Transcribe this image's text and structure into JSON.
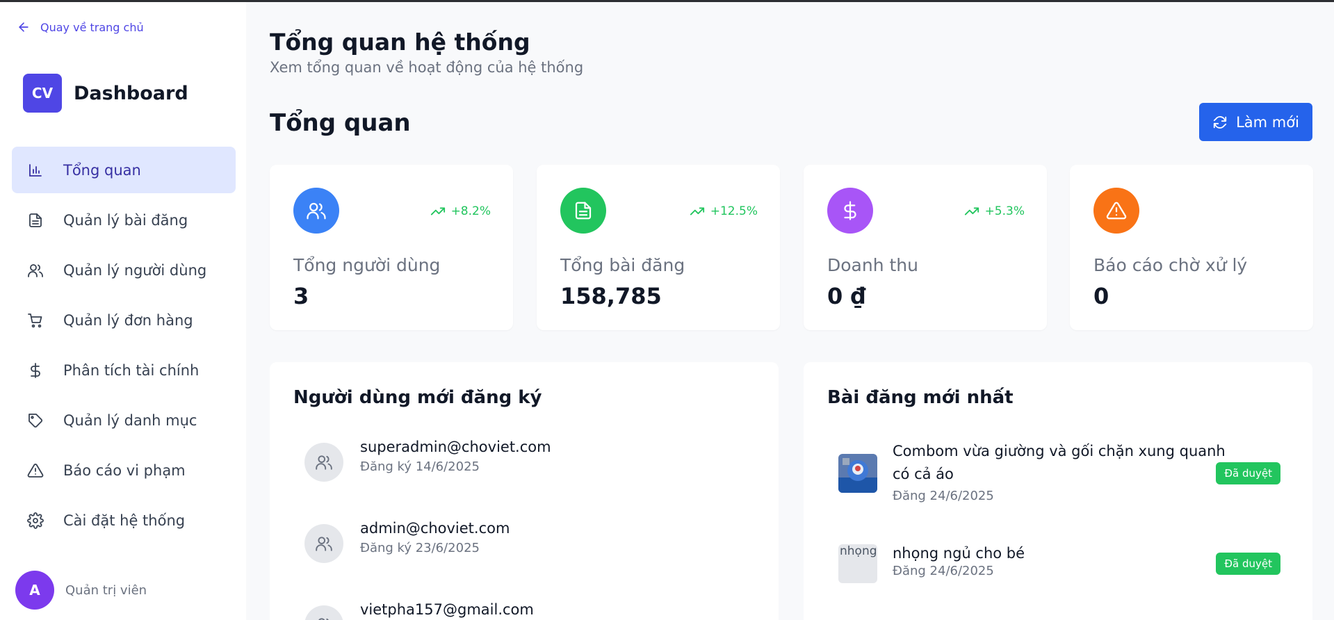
{
  "sidebar": {
    "back_link": "Quay về trang chủ",
    "logo_text": "CV",
    "brand_title": "Dashboard",
    "items": [
      {
        "label": "Tổng quan",
        "icon": "bar-chart-icon",
        "active": true
      },
      {
        "label": "Quản lý bài đăng",
        "icon": "document-icon",
        "active": false
      },
      {
        "label": "Quản lý người dùng",
        "icon": "users-icon",
        "active": false
      },
      {
        "label": "Quản lý đơn hàng",
        "icon": "cart-icon",
        "active": false
      },
      {
        "label": "Phân tích tài chính",
        "icon": "dollar-icon",
        "active": false
      },
      {
        "label": "Quản lý danh mục",
        "icon": "tag-icon",
        "active": false
      },
      {
        "label": "Báo cáo vi phạm",
        "icon": "warning-icon",
        "active": false
      },
      {
        "label": "Cài đặt hệ thống",
        "icon": "gear-icon",
        "active": false
      }
    ],
    "user": {
      "avatar_letter": "A",
      "role": "Quản trị viên"
    }
  },
  "header": {
    "title": "Tổng quan hệ thống",
    "subtitle": "Xem tổng quan về hoạt động của hệ thống"
  },
  "overview": {
    "title": "Tổng quan",
    "refresh_label": "Làm mới"
  },
  "stats": [
    {
      "label": "Tổng người dùng",
      "value": "3",
      "change": "+8.2%",
      "color": "#3b82f6",
      "icon": "users-icon"
    },
    {
      "label": "Tổng bài đăng",
      "value": "158,785",
      "change": "+12.5%",
      "color": "#22c55e",
      "icon": "document-icon"
    },
    {
      "label": "Doanh thu",
      "value": "0 ₫",
      "change": "+5.3%",
      "color": "#a855f7",
      "icon": "dollar-icon"
    },
    {
      "label": "Báo cáo chờ xử lý",
      "value": "0",
      "change": "",
      "color": "#f97316",
      "icon": "warning-icon"
    }
  ],
  "new_users": {
    "title": "Người dùng mới đăng ký",
    "items": [
      {
        "email": "superadmin@choviet.com",
        "date": "Đăng ký 14/6/2025"
      },
      {
        "email": "admin@choviet.com",
        "date": "Đăng ký 23/6/2025"
      },
      {
        "email": "vietpha157@gmail.com",
        "date": ""
      }
    ]
  },
  "latest_posts": {
    "title": "Bài đăng mới nhất",
    "items": [
      {
        "title": "Combom vừa giường và gối chặn xung quanh có cả áo",
        "date": "Đăng 24/6/2025",
        "status": "Đã duyệt",
        "thumb_alt": ""
      },
      {
        "title": "nhọng ngủ cho bé",
        "date": "Đăng 24/6/2025",
        "status": "Đã duyệt",
        "thumb_alt": "nhọng"
      }
    ]
  }
}
